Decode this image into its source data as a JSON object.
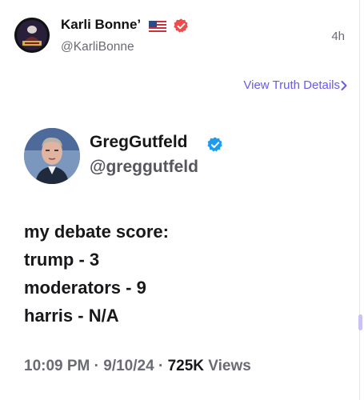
{
  "post": {
    "author_name": "Karli Bonne’",
    "author_handle": "@KarliBonne",
    "timestamp": "4h",
    "details_link": "View Truth Details",
    "colors": {
      "accent": "#6b59e8",
      "verified_badge": "#ee4b4b"
    },
    "icons": [
      "us-flag-icon",
      "verified-badge-icon",
      "chevron-right-icon"
    ]
  },
  "quoted": {
    "name": "GregGutfeld",
    "handle": "@greggutfeld",
    "lines": [
      "my debate score:",
      "trump - 3",
      "moderators - 9",
      "harris - N/A"
    ],
    "time": "10:09 PM",
    "date": "9/10/24",
    "views_count": "725K",
    "views_label": "Views",
    "separator": "·",
    "colors": {
      "verified_badge": "#1d9bf0"
    }
  }
}
